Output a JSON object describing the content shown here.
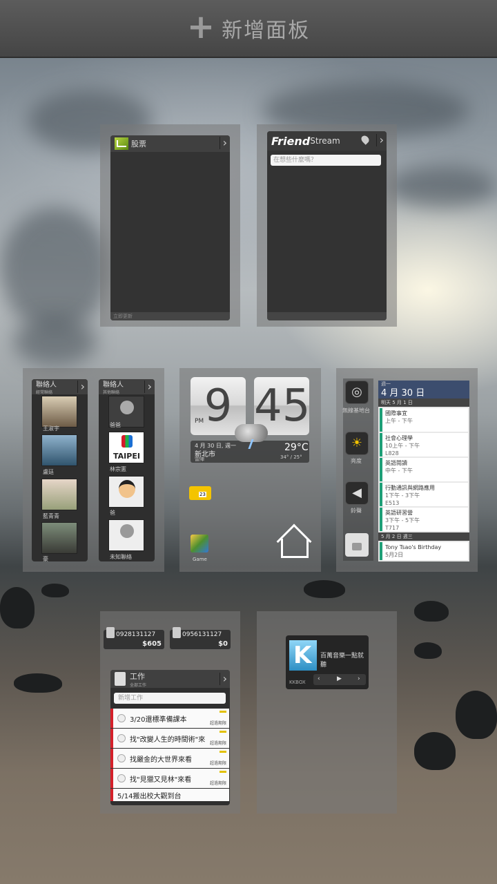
{
  "header": {
    "add_panel_label": "新增面板"
  },
  "stocks_widget": {
    "title": "股票",
    "footer": "立即更新"
  },
  "friendstream_widget": {
    "brand_bold": "Friend",
    "brand_light": "Stream",
    "status_placeholder": "在想些什麼嗎？"
  },
  "people_widget_1": {
    "title": "聯絡人",
    "subtitle": "經常聯絡",
    "contacts": [
      "王淑宇",
      "盧廷",
      "藍青青",
      "豪"
    ]
  },
  "people_widget_2": {
    "title": "聯絡人",
    "subtitle": "其他聯絡",
    "contacts": [
      "爸爸",
      "林宗憲",
      "爸",
      "未知聯絡"
    ],
    "taipei_label": "TAIPEI"
  },
  "clock_widget": {
    "hour": "9",
    "minute": "45",
    "ampm": "PM",
    "date": "4 月 30 日, 週一",
    "location": "新北市",
    "condition": "雷陣",
    "temp": "29°C",
    "range": "34° / 25°",
    "calendar_badge": "23",
    "folder_label": "Game"
  },
  "settings_widget": {
    "wifi_label": "無線基地台",
    "brightness_label": "亮度",
    "sound_label": "鈴聲",
    "calendar_weekday": "週一",
    "calendar_date": "4 月 30 日",
    "section_tomorrow": "明天 5 月 1 日",
    "events": [
      {
        "title": "國際事宜",
        "time": "上午 - 下午"
      },
      {
        "title": "社會心理學",
        "time": "10上午 - 下午",
        "room": "L828"
      },
      {
        "title": "英語閱讀",
        "time": "中午 - 下午"
      },
      {
        "title": "行動通訊與網路應用",
        "time": "1下午 - 3下午",
        "room": "E513"
      },
      {
        "title": "英語研習營",
        "time": "3下午 - 5下午",
        "room": "T717"
      }
    ],
    "section_next": "5 月 2 日 週三",
    "birthday_title": "Tony Tsao's Birthday",
    "birthday_date": "5月2日"
  },
  "phone_widget": {
    "sim1_number": "0928131127",
    "sim1_amount": "$605",
    "sim2_number": "0956131127",
    "sim2_amount": "$0"
  },
  "tasks_widget": {
    "title": "工作",
    "subtitle": "全部工作",
    "new_task_placeholder": "新增工作",
    "tasks": [
      {
        "text": "3/20還標準備課本",
        "tag": "超過期限"
      },
      {
        "text": "找\"改變人生的時間術\"來",
        "tag": "超過期限"
      },
      {
        "text": "找嚴金的大世界來看",
        "tag": "超過期限"
      },
      {
        "text": "找\"見獵又見林\"來看",
        "tag": "超過期限"
      },
      {
        "text": "5/14搬出校大觀到台",
        "tag": ""
      }
    ]
  },
  "music_widget": {
    "title": "百萬音樂一點就聽",
    "brand": "KKBOX",
    "k_letter": "K"
  },
  "colors": {
    "tasks_accent": "#d4202a",
    "calendar_accent": "#1e9f77",
    "calendar_header": "#3c4d6e"
  },
  "icons": [
    "plus-icon",
    "stock-icon",
    "location-pin-icon",
    "chevron-right-icon",
    "wifi-icon",
    "sun-icon",
    "speaker-icon",
    "lock-icon",
    "home-icon",
    "weather-storm-icon"
  ]
}
